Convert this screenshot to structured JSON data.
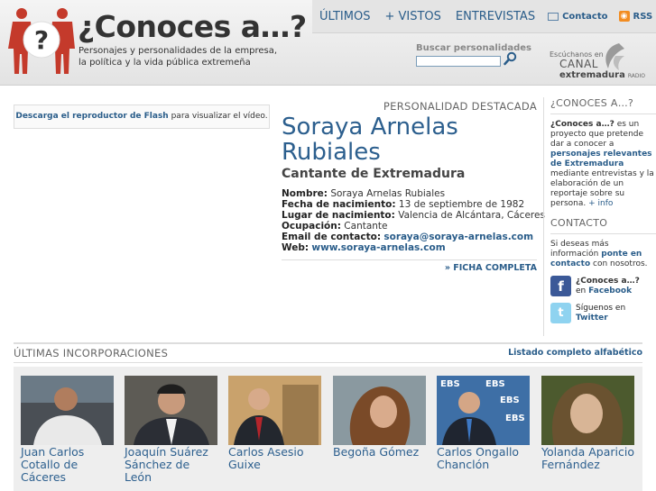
{
  "header": {
    "logo_glyph": "?",
    "title": "¿Conoces a…?",
    "tagline": "Personajes y personalidades de la empresa, la política y la vida pública extremeña"
  },
  "nav": {
    "items": [
      "ÚLTIMOS",
      "+ VISTOS",
      "ENTREVISTAS"
    ],
    "contact": "Contacto",
    "rss": "RSS"
  },
  "search": {
    "label": "Buscar personalidades",
    "value": "",
    "placeholder": ""
  },
  "radio": {
    "listen_text": "Escúchanos en",
    "brand_top": "CANAL",
    "brand_bottom": "extremadura",
    "brand_radio": "RADIO"
  },
  "video": {
    "link_text": "Descarga el reproductor de Flash",
    "rest_text": "para visualizar el vídeo."
  },
  "featured": {
    "heading": "PERSONALIDAD DESTACADA",
    "name": "Soraya Arnelas Rubiales",
    "subtitle": "Cantante de Extremadura",
    "details": [
      {
        "key": "Nombre:",
        "value": "Soraya Arnelas Rubiales"
      },
      {
        "key": "Fecha de nacimiento:",
        "value": "13 de septiembre de 1982"
      },
      {
        "key": "Lugar de nacimiento:",
        "value": "Valencia de Alcántara, Cáceres"
      },
      {
        "key": "Ocupación:",
        "value": "Cantante"
      },
      {
        "key": "Email de contacto:",
        "value": "soraya@soraya-arnelas.com"
      },
      {
        "key": "Web:",
        "value": "www.soraya-arnelas.com"
      }
    ],
    "more_link": "» FICHA COMPLETA"
  },
  "sidebar": {
    "about_heading": "¿CONOCES A…?",
    "about_title": "¿Conoces a…?",
    "about_text_1": "es un proyecto que pretende dar a conocer a",
    "about_highlight": "personajes relevantes de Extremadura",
    "about_text_2": "mediante entrevistas y la elaboración de un reportaje sobre su persona.",
    "about_more": "+ info",
    "contact_heading": "CONTACTO",
    "contact_text_1": "Si deseas más información",
    "contact_link": "ponte en contacto",
    "contact_text_2": "con nosotros.",
    "facebook_glyph": "f",
    "facebook_title": "¿Conoces a…?",
    "facebook_prefix": "en",
    "facebook_name": "Facebook",
    "twitter_glyph": "t",
    "twitter_text": "Síguenos en",
    "twitter_name": "Twitter"
  },
  "latest": {
    "heading": "ÚLTIMAS INCORPORACIONES",
    "alpha_link": "Listado completo alfabético",
    "people": [
      {
        "name": "Juan Carlos Cotallo de Cáceres"
      },
      {
        "name": "Joaquín Suárez Sánchez de León"
      },
      {
        "name": "Carlos Asesio Guixe"
      },
      {
        "name": "Begoña Gómez"
      },
      {
        "name": "Carlos Ongallo Chanclón"
      },
      {
        "name": "Yolanda Aparicio Fernández"
      }
    ]
  },
  "colors": {
    "accent_blue": "#2c5f8e",
    "logo_red": "#c43a2b",
    "rss_orange": "#f28c21",
    "facebook_blue": "#3b5998",
    "twitter_blue": "#8fd3f0"
  }
}
